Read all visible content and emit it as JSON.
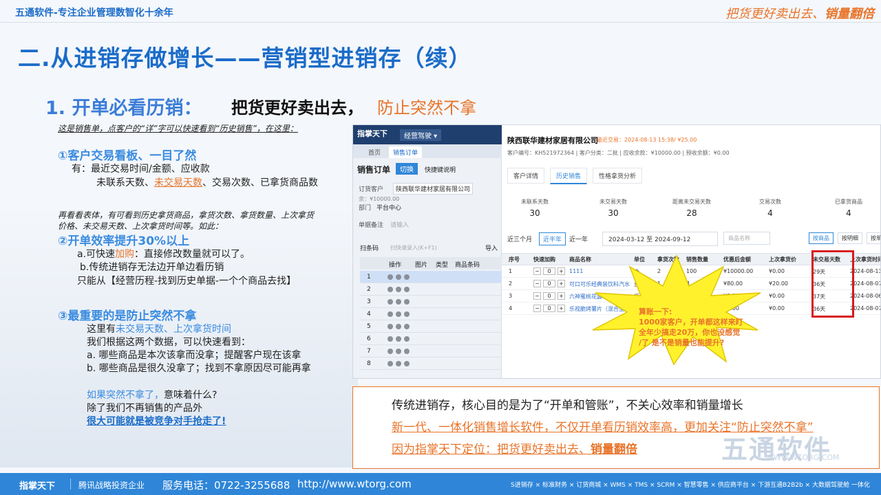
{
  "header": {
    "company": "五通软件-专注企业管理数智化十余年",
    "slogan_main": "把货更好卖出去、",
    "slogan_bold": "销量翻倍"
  },
  "title": "二.从进销存做增长——营销型进销存（续）",
  "subtitle": {
    "part1": "1. 开单必看历销：",
    "part2": "把货更好卖出去，",
    "part3": "防止突然不拿"
  },
  "intro": "这是销售单，点客户的“详”字可以快速看到“历史销售”，在这里：",
  "sec1": {
    "title": "①客户交易看板、一目了然",
    "line1": "有：最近交易时间/金额、应收款",
    "line2a": "未联系天数、",
    "line2b": "未交易天数",
    "line2c": "、交易次数、已拿货商品数"
  },
  "note2": {
    "line1": "再看看表体，有可看到历史拿货商品，拿货次数、拿货数量、上次拿货",
    "line2": "价格、未交易天数、上次拿货时间等。如此："
  },
  "sec2": {
    "title": "②开单效率提升30%以上",
    "a1": "a.可快速",
    "a2": "加购",
    "a3": "：直接修改数量就可以了。",
    "b": "b.传统进销存无法边开单边看历销",
    "c": "只能从【经营历程-找到历史单据-一个个商品去找】"
  },
  "sec3": {
    "title": "③最重要的是防止突然不拿",
    "l1a": "这里有",
    "l1b": "未交易天数、上次拿货时间",
    "l2": "我们根据这两个数据，可以快速看到：",
    "l3": "a. 哪些商品是本次该拿而没拿；提醒客户现在该拿",
    "l4": "b. 哪些商品是很久没拿了；找到不拿原因尽可能再拿"
  },
  "sec4": {
    "l1a": "如果突然不拿了，",
    "l1b": "意味着什么?",
    "l2": "除了我们不再销售的产品外",
    "l3": "很大可能就是被竞争对手抢走了!"
  },
  "shot": {
    "left": {
      "logo": "指掌天下",
      "menu": "经营驾驶 ▾",
      "tab_home": "首页",
      "tab_order": "销售订单",
      "order_title": "销售订单",
      "switch": "切换",
      "shortcut": "快捷键说明",
      "kv_ordered": "订货客户",
      "kv_customer": "陕西联华建材家居有限公司",
      "kv_money": "余：¥10000.00",
      "kv_dept": "部门",
      "kv_dept_val": "平台中心",
      "kv_remark": "单据备注",
      "kv_remark_ph": "请输入",
      "scan": "扫条码",
      "scan_ph": "扫快速录入(K+F1)",
      "import": "导入",
      "th": [
        "操作",
        "图片",
        "类型",
        "商品条码"
      ],
      "rows": [
        "1",
        "2",
        "3",
        "4",
        "5",
        "6",
        "7",
        "8"
      ]
    },
    "right": {
      "customer": "陕西联华建材家居有限公司",
      "last": "最近交易：2024-08-13 15:38/ ¥25.00",
      "info": "客户编号：KH521972364 | 客户分类：二批 | 应收余款：¥10000.00 | 预收余额：¥0.00",
      "tabs": [
        "客户详情",
        "历史销售",
        "性格拿货分析"
      ],
      "stats": [
        {
          "label": "未联系天数",
          "value": "30"
        },
        {
          "label": "未交易天数",
          "value": "30"
        },
        {
          "label": "距离未交易天数",
          "value": "28"
        },
        {
          "label": "交易次数",
          "value": "4"
        },
        {
          "label": "已拿货商品",
          "value": "4"
        }
      ],
      "filters": [
        "近三个月",
        "近半年",
        "近一年"
      ],
      "date_range": "2024-03-12 至 2024-09-12",
      "search_ph": "商品名称",
      "btns": [
        "按商品",
        "按明细",
        "按单据"
      ],
      "th": [
        "序号",
        "快速加购",
        "商品名称",
        "单位",
        "拿货次数",
        "销售数量",
        "优惠后金额",
        "上次拿货价",
        "未交易天数",
        "上次拿货时间"
      ],
      "rows": [
        {
          "no": "1",
          "qty": "0",
          "name": "1111",
          "unit": "个",
          "times": "2",
          "num": "100",
          "amt": "¥10000.00",
          "price": "¥0.00",
          "days": "29天",
          "date": "2024-08-13"
        },
        {
          "no": "2",
          "qty": "0",
          "name": "可口可乐经典装饮料汽水",
          "unit": "合",
          "times": "1",
          "num": "4",
          "amt": "¥80.00",
          "price": "¥20.00",
          "days": "36天",
          "date": "2024-08-07"
        },
        {
          "no": "3",
          "qty": "0",
          "name": "六神蜜桃花露水",
          "unit": "瓶",
          "times": "1",
          "num": "",
          "amt": "¥0.00",
          "price": "¥0.00",
          "days": "37天",
          "date": "2024-08-06"
        },
        {
          "no": "4",
          "qty": "0",
          "name": "乐视脆烤薯片（混合型）",
          "unit": "",
          "times": "",
          "num": "",
          "amt": "¥0.00",
          "price": "¥0.00",
          "days": "36天",
          "date": "2024-08-07"
        }
      ]
    },
    "callout": {
      "l1": "算账一下:",
      "l2": "1000家客户，开单都这样来盯",
      "l3": "全年少搞走20万，你也没感觉",
      "l4": "/了 是不是销量也能提升?"
    }
  },
  "bottom": {
    "l1": "传统进销存，核心目的是为了“开单和管账”，不关心效率和销量增长",
    "l2": "新一代、一体化销售增长软件，不仅开单看历销效率高，更加关注“防止突然不拿”",
    "l3a": "因为指掌天下定位：把货更好卖出去、",
    "l3b": "销量翻倍",
    "watermark": "五通软件",
    "watermark_url": "WWW.WTORG.COM"
  },
  "footer": {
    "logo": "指掌天下",
    "sub": "腾讯战略投资企业",
    "phone": "服务电话：0722-3255688",
    "url": "http://www.wtorg.com",
    "products": "S进销存 × 标准财务 × 订货商城 × WMS × TMS × SCRM × 智慧零售 × 供应商平台 × 下游互通B2B2b × 大数据驾驶舱 一体化"
  }
}
